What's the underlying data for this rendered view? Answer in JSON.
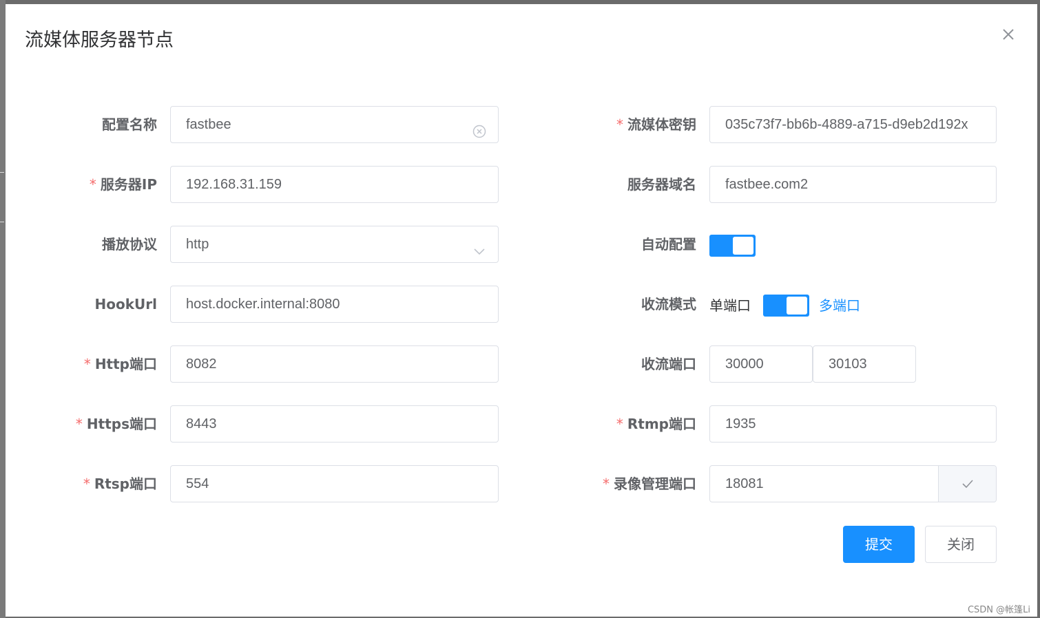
{
  "dialog": {
    "title": "流媒体服务器节点",
    "close_icon": "close-icon"
  },
  "form": {
    "config_name": {
      "label": "配置名称",
      "required": false,
      "value": "fastbee",
      "suffix_icon": "clear-circle-icon"
    },
    "media_secret": {
      "label": "流媒体密钥",
      "required": true,
      "value": "035c73f7-bb6b-4889-a715-d9eb2d192x"
    },
    "server_ip": {
      "label": "服务器IP",
      "required": true,
      "value": "192.168.31.159"
    },
    "server_domain": {
      "label": "服务器域名",
      "required": false,
      "value": "fastbee.com2"
    },
    "play_protocol": {
      "label": "播放协议",
      "required": false,
      "value": "http",
      "suffix_icon": "chevron-down-icon"
    },
    "auto_config": {
      "label": "自动配置",
      "enabled": true
    },
    "hook_url": {
      "label": "HookUrl",
      "required": false,
      "value": "host.docker.internal:8080"
    },
    "stream_mode": {
      "label": "收流模式",
      "inactive_text": "单端口",
      "active_text": "多端口",
      "enabled": true
    },
    "http_port": {
      "label": "Http端口",
      "required": true,
      "value": "8082"
    },
    "stream_ports": {
      "label": "收流端口",
      "required": false,
      "start": "30000",
      "end": "30103"
    },
    "https_port": {
      "label": "Https端口",
      "required": true,
      "value": "8443"
    },
    "rtmp_port": {
      "label": "Rtmp端口",
      "required": true,
      "value": "1935"
    },
    "rtsp_port": {
      "label": "Rtsp端口",
      "required": true,
      "value": "554"
    },
    "record_port": {
      "label": "录像管理端口",
      "required": true,
      "value": "18081",
      "append_icon": "check-icon"
    }
  },
  "buttons": {
    "submit": "提交",
    "close": "关闭"
  },
  "required_mark": "*",
  "watermark": "CSDN @帐篷Li",
  "colors": {
    "primary": "#1890ff",
    "required": "#f56c6c",
    "label": "#606266",
    "border": "#dcdfe6"
  }
}
